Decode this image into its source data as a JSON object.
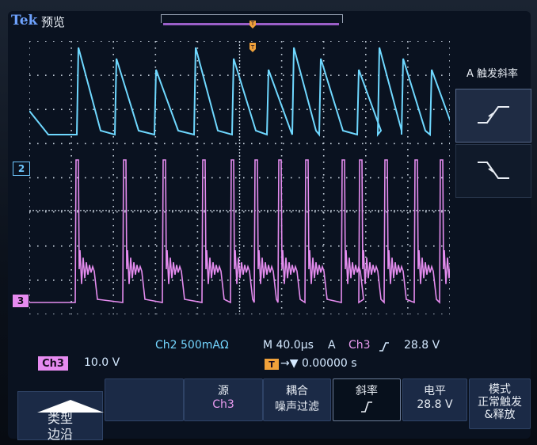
{
  "header": {
    "brand": "Tek",
    "mode": "预览"
  },
  "channels": {
    "ch2": {
      "label": "2",
      "color": "#6fc8ff"
    },
    "ch3": {
      "label": "3",
      "color": "#e78bf0"
    }
  },
  "side_menu": {
    "title": "A 触发斜率",
    "rising_icon": "rising-edge-icon",
    "falling_icon": "falling-edge-icon"
  },
  "status": {
    "ch2_scale": "Ch2  500mAΩ",
    "timebase": "M 40.0µs",
    "trig_mode": "A",
    "trig_src": "Ch3",
    "trig_level": "28.8 V",
    "ch3_chip": "Ch3",
    "ch3_scale": "10.0 V",
    "trig_pos_chip": "T",
    "trig_pos": "→▼ 0.00000 s"
  },
  "bottom_menu": {
    "type_top": "类型",
    "type_bottom": "边沿",
    "source_top": "源",
    "source_bottom": "Ch3",
    "coupling_top": "耦合",
    "coupling_bottom": "噪声过滤",
    "slope_top": "斜率",
    "slope_icon": "rising-slope-icon",
    "level_top": "电平",
    "level_bottom": "28.8 V",
    "mode_top": "模式",
    "mode_mid": "正常触发",
    "mode_bottom": "&释放"
  },
  "colors": {
    "ch2_trace": "#6fd8ff",
    "ch3_trace": "#e58cef",
    "grid": "#c9d3df",
    "menu_bg": "#1b2a46",
    "trigger": "#f0a13a"
  }
}
